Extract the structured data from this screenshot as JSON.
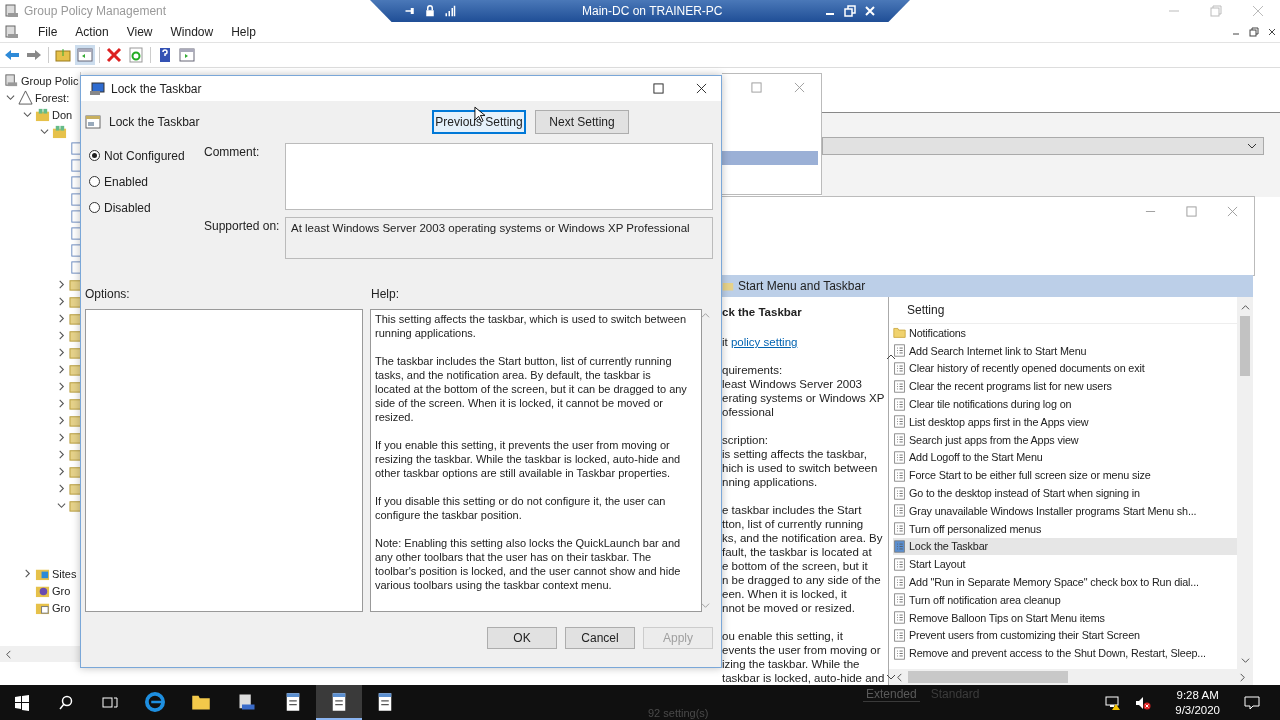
{
  "remote_bar": {
    "title": "Main-DC on TRAINER-PC"
  },
  "main_window": {
    "title": "Group Policy Management",
    "menu": [
      "File",
      "Action",
      "View",
      "Window",
      "Help"
    ],
    "tree": [
      {
        "label": "Group Polic",
        "kind": "root",
        "children": [
          {
            "label": "Forest: ",
            "kind": "forest",
            "expanded": true,
            "children": [
              {
                "label": "Don",
                "kind": "domains",
                "expanded": true,
                "children": [
                  {
                    "kind": "domain",
                    "expanded": true,
                    "children": [
                      {
                        "kind": "link"
                      },
                      {
                        "kind": "link"
                      },
                      {
                        "kind": "link"
                      },
                      {
                        "kind": "link"
                      },
                      {
                        "kind": "link"
                      },
                      {
                        "kind": "link"
                      },
                      {
                        "kind": "link"
                      },
                      {
                        "kind": "link"
                      },
                      {
                        "kind": "ou",
                        "expanded": false
                      },
                      {
                        "kind": "ou",
                        "expanded": false
                      },
                      {
                        "kind": "ou",
                        "expanded": false
                      },
                      {
                        "kind": "ou",
                        "expanded": false
                      },
                      {
                        "kind": "ou",
                        "expanded": false
                      },
                      {
                        "kind": "ou",
                        "expanded": false
                      },
                      {
                        "kind": "ou",
                        "expanded": false
                      },
                      {
                        "kind": "ou",
                        "expanded": false
                      },
                      {
                        "kind": "ou",
                        "expanded": false
                      },
                      {
                        "kind": "ou",
                        "expanded": false
                      },
                      {
                        "kind": "ou",
                        "expanded": false
                      },
                      {
                        "kind": "ou",
                        "expanded": false
                      },
                      {
                        "kind": "ou",
                        "expanded": false
                      },
                      {
                        "kind": "ou",
                        "expanded": true
                      }
                    ]
                  }
                ]
              },
              {
                "label": "Sites",
                "kind": "sites",
                "expanded": false
              },
              {
                "label": "Gro",
                "kind": "modeling"
              },
              {
                "label": "Gro",
                "kind": "results"
              }
            ]
          }
        ]
      }
    ]
  },
  "editor_window": {
    "section_header": "Start Menu and Taskbar",
    "explanation": {
      "title": "ck the Taskbar",
      "link_prefix": "it ",
      "link": "policy setting",
      "paragraphs": [
        "quirements:\nleast Windows Server 2003\nerating systems or Windows XP\nofessional",
        "scription:\nis setting affects the taskbar,\nhich is used to switch between\nnning applications.",
        "e taskbar includes the Start\ntton, list of currently running\nks, and the notification area. By\nfault, the taskbar is located at\ne bottom of the screen, but it\nn be dragged to any side of the\neen. When it is locked, it\nnnot be moved or resized.",
        "ou enable this setting, it\nevents the user from moving or\nizing the taskbar. While the\ntaskbar is locked, auto-hide and"
      ]
    },
    "settings_header": "Setting",
    "settings": [
      {
        "label": "Notifications",
        "kind": "folder",
        "selected": false
      },
      {
        "label": "Add Search Internet link to Start Menu",
        "kind": "policy",
        "selected": false
      },
      {
        "label": "Clear history of recently opened documents on exit",
        "kind": "policy",
        "selected": false
      },
      {
        "label": "Clear the recent programs list for new users",
        "kind": "policy",
        "selected": false
      },
      {
        "label": "Clear tile notifications during log on",
        "kind": "policy",
        "selected": false
      },
      {
        "label": "List desktop apps first in the Apps view",
        "kind": "policy",
        "selected": false
      },
      {
        "label": "Search just apps from the Apps view",
        "kind": "policy",
        "selected": false
      },
      {
        "label": "Add Logoff to the Start Menu",
        "kind": "policy",
        "selected": false
      },
      {
        "label": "Force Start to be either full screen size or menu size",
        "kind": "policy",
        "selected": false
      },
      {
        "label": "Go to the desktop instead of Start when signing in",
        "kind": "policy",
        "selected": false
      },
      {
        "label": "Gray unavailable Windows Installer programs Start Menu sh...",
        "kind": "policy",
        "selected": false
      },
      {
        "label": "Turn off personalized menus",
        "kind": "policy",
        "selected": false
      },
      {
        "label": "Lock the Taskbar",
        "kind": "policy",
        "selected": true
      },
      {
        "label": "Start Layout",
        "kind": "policy",
        "selected": false
      },
      {
        "label": "Add \"Run in Separate Memory Space\" check box to Run dial...",
        "kind": "policy",
        "selected": false
      },
      {
        "label": "Turn off notification area cleanup",
        "kind": "policy",
        "selected": false
      },
      {
        "label": "Remove Balloon Tips on Start Menu items",
        "kind": "policy",
        "selected": false
      },
      {
        "label": "Prevent users from customizing their Start Screen",
        "kind": "policy",
        "selected": false
      },
      {
        "label": "Remove and prevent access to the Shut Down, Restart, Sleep...",
        "kind": "policy",
        "selected": false
      }
    ],
    "view_tabs": [
      {
        "label": "Extended",
        "selected": true
      },
      {
        "label": "Standard",
        "selected": false
      }
    ],
    "status": "92 setting(s)"
  },
  "dialog": {
    "title": "Lock the Taskbar",
    "heading": "Lock the Taskbar",
    "nav_buttons": [
      {
        "label": "Previous Setting",
        "focused": true
      },
      {
        "label": "Next Setting",
        "focused": false
      }
    ],
    "radios": [
      {
        "label": "Not Configured",
        "selected": true
      },
      {
        "label": "Enabled",
        "selected": false
      },
      {
        "label": "Disabled",
        "selected": false
      }
    ],
    "comment_label": "Comment:",
    "supported_label": "Supported on:",
    "supported_on": "At least Windows Server 2003 operating systems or Windows XP Professional",
    "options_label": "Options:",
    "help_label": "Help:",
    "help": [
      "This setting affects the taskbar, which is used to switch between running applications.",
      "The taskbar includes the Start button, list of currently running tasks, and the notification area. By default, the taskbar is located at the bottom of the screen, but it can be dragged to any side of the screen. When it is locked, it cannot be moved or resized.",
      "If you enable this setting, it prevents the user from moving or resizing the taskbar. While the taskbar is locked, auto-hide and other taskbar options are still available in Taskbar properties.",
      "If you disable this setting or do not configure it, the user can configure the taskbar position.",
      "Note: Enabling this setting also locks the QuickLaunch bar and any other toolbars that the user has on their taskbar. The toolbar's position is locked, and the user cannot show and hide various toolbars using the taskbar context menu."
    ],
    "buttons": [
      {
        "label": "OK",
        "disabled": false
      },
      {
        "label": "Cancel",
        "disabled": false
      },
      {
        "label": "Apply",
        "disabled": true
      }
    ]
  },
  "taskbar": {
    "apps": [
      {
        "kind": "browser",
        "active": false
      },
      {
        "kind": "folder",
        "active": false
      },
      {
        "kind": "console",
        "active": false
      },
      {
        "kind": "notepad",
        "active": false
      },
      {
        "kind": "notepad",
        "active": true
      },
      {
        "kind": "notepad",
        "active": false
      }
    ],
    "time": "9:28 AM",
    "date": "9/3/2020"
  }
}
